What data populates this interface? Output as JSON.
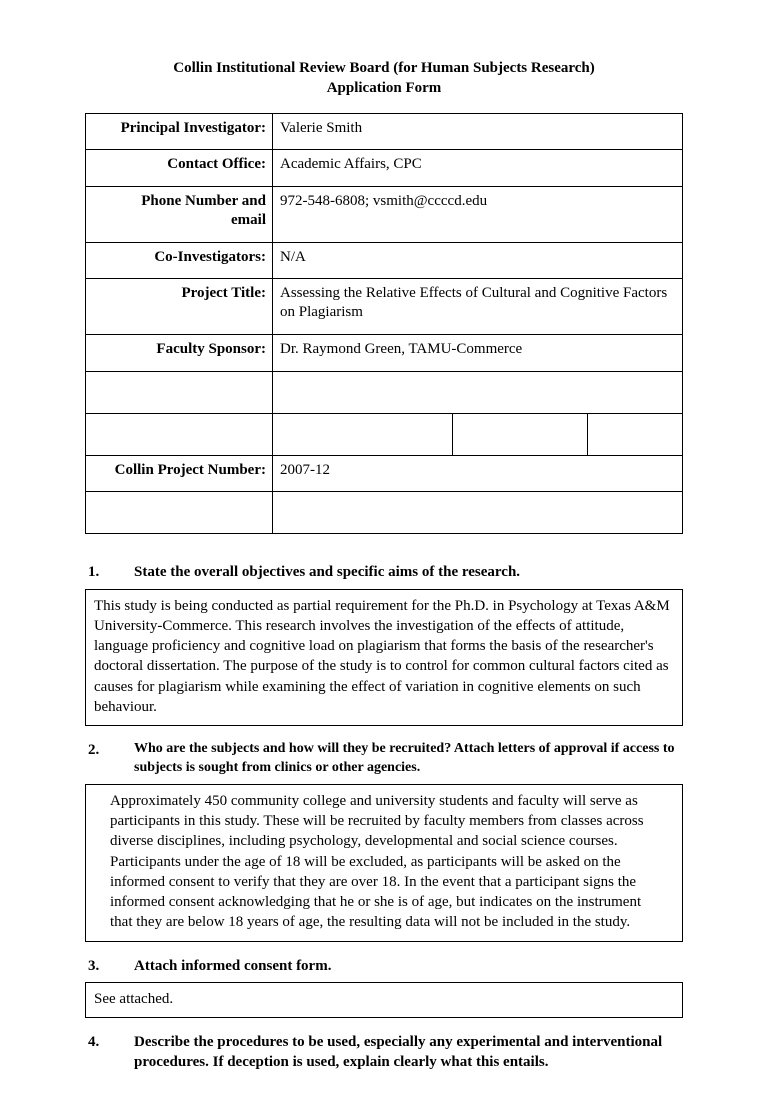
{
  "title": {
    "line1": "Collin Institutional Review Board (for Human Subjects Research)",
    "line2": "Application Form"
  },
  "info": {
    "pi_label": "Principal Investigator:",
    "pi_value": "Valerie Smith",
    "office_label": "Contact Office:",
    "office_value": "Academic Affairs, CPC",
    "phone_label1": "Phone Number and",
    "phone_label2": "email",
    "phone_value": "972-548-6808; vsmith@ccccd.edu",
    "coinv_label": "Co-Investigators:",
    "coinv_value": "N/A",
    "proj_title_label": "Project Title:",
    "proj_title_value": "Assessing the Relative Effects of Cultural and Cognitive Factors on Plagiarism",
    "sponsor_label": "Faculty Sponsor:",
    "sponsor_value": "Dr. Raymond Green, TAMU-Commerce",
    "projnum_label": "Collin Project Number:",
    "projnum_value": "2007-12"
  },
  "q1": {
    "num": "1.",
    "text": "State the overall objectives and specific aims of the research.",
    "response": "This study is being conducted as partial requirement for the Ph.D. in Psychology at Texas A&M University-Commerce. This research involves the investigation of the effects of attitude, language proficiency and cognitive load on plagiarism that forms the basis of the researcher's doctoral dissertation. The purpose of the study is to control for common cultural factors cited as causes for plagiarism while examining the effect of variation in cognitive elements on such behaviour."
  },
  "q2": {
    "num": "2.",
    "text": "Who are the subjects and how will they be recruited? Attach letters of approval if access to subjects is sought from clinics or other agencies.",
    "response": "Approximately 450 community college and university students and faculty will serve as participants in this study. These will be recruited by faculty members from classes across diverse disciplines, including psychology, developmental and social science courses. Participants under the age of 18 will be excluded, as participants will be asked on the informed consent to verify that they are over 18. In the event that a participant signs the informed consent acknowledging that he or she is of age, but indicates on the instrument that they are below 18 years of age, the resulting data will not be included in the study."
  },
  "q3": {
    "num": "3.",
    "text": "Attach informed consent form.",
    "response": "See attached."
  },
  "q4": {
    "num": "4.",
    "text": "Describe the procedures to be used, especially any experimental and interventional procedures.  If deception is used, explain clearly what this entails."
  }
}
